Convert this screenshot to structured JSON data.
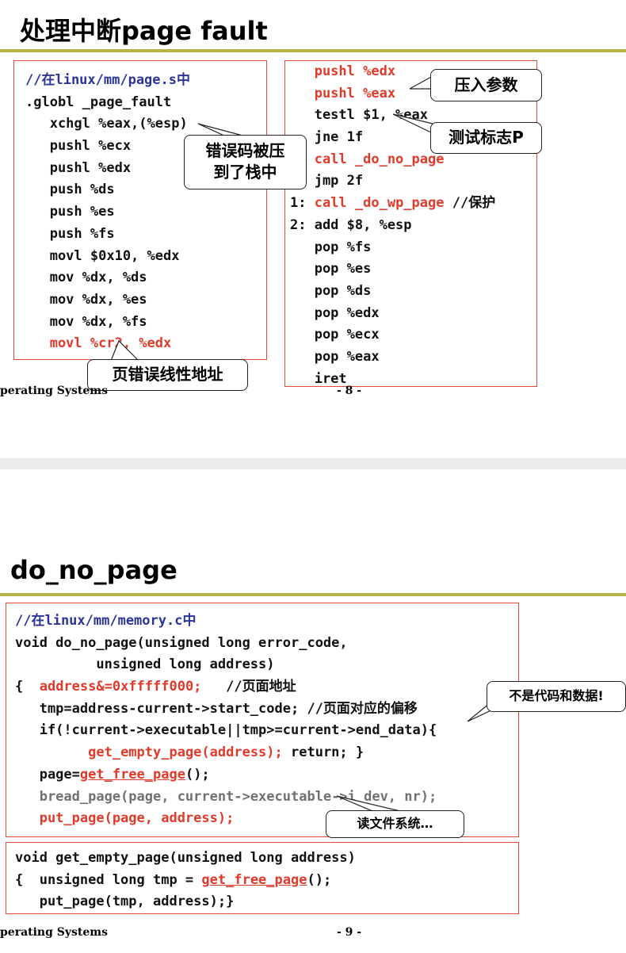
{
  "slide8": {
    "title": "处理中断page fault",
    "left_code": [
      [
        {
          "t": "//在linux/mm/page.s中",
          "c": "blue"
        }
      ],
      [
        {
          "t": ".globl _page_fault",
          "c": ""
        }
      ],
      [
        {
          "t": "   xchgl %eax,(%esp)",
          "c": ""
        }
      ],
      [
        {
          "t": "   pushl %ecx",
          "c": ""
        }
      ],
      [
        {
          "t": "   pushl %edx",
          "c": ""
        }
      ],
      [
        {
          "t": "   push %ds",
          "c": ""
        }
      ],
      [
        {
          "t": "   push %es",
          "c": ""
        }
      ],
      [
        {
          "t": "   push %fs",
          "c": ""
        }
      ],
      [
        {
          "t": "   movl $0x10, %edx",
          "c": ""
        }
      ],
      [
        {
          "t": "   mov %dx, %ds",
          "c": ""
        }
      ],
      [
        {
          "t": "   mov %dx, %es",
          "c": ""
        }
      ],
      [
        {
          "t": "   mov %dx, %fs",
          "c": ""
        }
      ],
      [
        {
          "t": "   movl %cr2, %edx",
          "c": "red"
        }
      ]
    ],
    "right_code": [
      [
        {
          "t": "   pushl %edx",
          "c": "red"
        }
      ],
      [
        {
          "t": "   pushl %eax",
          "c": "red"
        }
      ],
      [
        {
          "t": "   testl $1, %eax",
          "c": ""
        }
      ],
      [
        {
          "t": "   jne 1f",
          "c": ""
        }
      ],
      [
        {
          "t": "   call _do_no_page",
          "c": "red"
        }
      ],
      [
        {
          "t": "   jmp 2f",
          "c": ""
        }
      ],
      [
        {
          "t": "1: ",
          "c": ""
        },
        {
          "t": "call _do_wp_page",
          "c": "red"
        },
        {
          "t": " //保护",
          "c": ""
        }
      ],
      [
        {
          "t": "2: add $8, %esp",
          "c": ""
        }
      ],
      [
        {
          "t": "   pop %fs",
          "c": ""
        }
      ],
      [
        {
          "t": "   pop %es",
          "c": ""
        }
      ],
      [
        {
          "t": "   pop %ds",
          "c": ""
        }
      ],
      [
        {
          "t": "   pop %edx",
          "c": ""
        }
      ],
      [
        {
          "t": "   pop %ecx",
          "c": ""
        }
      ],
      [
        {
          "t": "   pop %eax",
          "c": ""
        }
      ],
      [
        {
          "t": "   iret",
          "c": ""
        }
      ]
    ],
    "callout_push_params": "压入参数",
    "callout_test_flag": "测试标志P",
    "callout_error_code": "错误码被压\n到了栈中",
    "callout_fault_addr": "页错误线性地址",
    "footer_left": "perating Systems",
    "footer_page": "- 8 -"
  },
  "slide9": {
    "title": "do_no_page",
    "main_code": [
      [
        {
          "t": "//在linux/mm/memory.c中",
          "c": "blue"
        }
      ],
      [
        {
          "t": "void do_no_page(unsigned long error_code,",
          "c": ""
        }
      ],
      [
        {
          "t": "          unsigned long address)",
          "c": ""
        }
      ],
      [
        {
          "t": "{  ",
          "c": ""
        },
        {
          "t": "address&=0xfffff000;",
          "c": "red"
        },
        {
          "t": "   //页面地址",
          "c": ""
        }
      ],
      [
        {
          "t": "   tmp=address-current->start_code; //页面对应的偏移",
          "c": ""
        }
      ],
      [
        {
          "t": "   if(!current->executable||tmp>=current->end_data){",
          "c": ""
        }
      ],
      [
        {
          "t": "         ",
          "c": ""
        },
        {
          "t": "get_empty_page(address);",
          "c": "red"
        },
        {
          "t": " return; }",
          "c": ""
        }
      ],
      [
        {
          "t": "   page=",
          "c": ""
        },
        {
          "t": "get_free_page",
          "c": "red ul"
        },
        {
          "t": "();",
          "c": ""
        }
      ],
      [
        {
          "t": "   bread_page(page, current->executable->i_dev, nr);",
          "c": "gray"
        }
      ],
      [
        {
          "t": "   put_page(page, address);",
          "c": "red"
        }
      ]
    ],
    "sub_code": [
      [
        {
          "t": "void get_empty_page(unsigned long address)",
          "c": ""
        }
      ],
      [
        {
          "t": "{  unsigned long tmp = ",
          "c": ""
        },
        {
          "t": "get_free_page",
          "c": "red ul"
        },
        {
          "t": "();",
          "c": ""
        }
      ],
      [
        {
          "t": "   put_page(tmp, address);}",
          "c": ""
        }
      ]
    ],
    "callout_not_code_data": "不是代码和数据!",
    "callout_read_fs": "读文件系统…",
    "footer_left": "perating Systems",
    "footer_page": "- 9 -"
  }
}
